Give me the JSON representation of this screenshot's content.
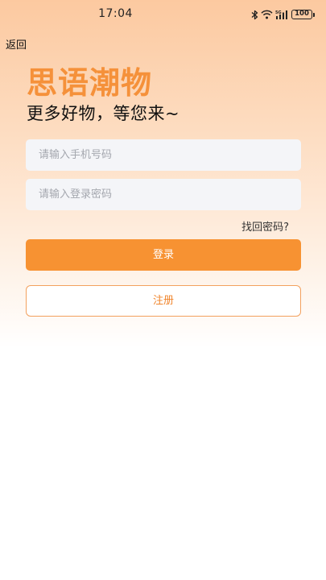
{
  "status_bar": {
    "time": "17:04",
    "icons": [
      "bluetooth-icon",
      "wifi-icon",
      "cellular-signal-icon",
      "battery-icon"
    ],
    "battery_level": "100"
  },
  "nav": {
    "back_label": "返回"
  },
  "brand": {
    "title": "思语潮物",
    "slogan": "更多好物，等您来~"
  },
  "form": {
    "phone_placeholder": "请输入手机号码",
    "phone_value": "",
    "password_placeholder": "请输入登录密码",
    "password_value": "",
    "forgot_label": "找回密码?",
    "login_label": "登录",
    "register_label": "注册"
  },
  "colors": {
    "accent": "#f79232",
    "brand_title": "#f5913a",
    "input_bg": "#f4f5f8"
  }
}
